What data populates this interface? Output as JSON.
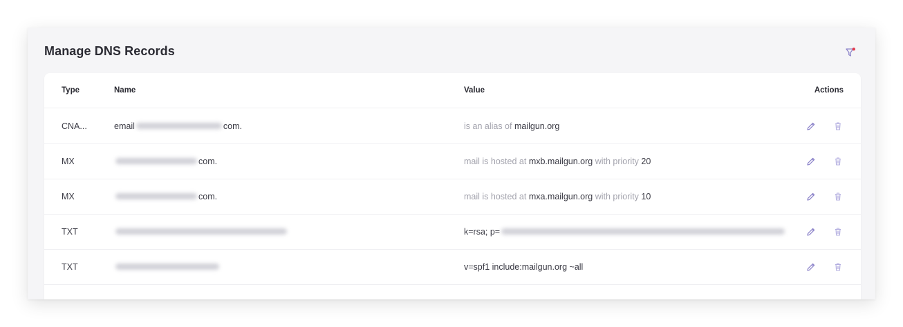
{
  "page": {
    "title": "Manage DNS Records"
  },
  "toolbar": {
    "filter_icon": "filter-icon"
  },
  "table": {
    "headers": {
      "type": "Type",
      "name": "Name",
      "value": "Value",
      "actions": "Actions"
    },
    "rows": [
      {
        "type": "CNA...",
        "name_prefix": "email",
        "name_suffix": "com.",
        "value_part1": "is an alias of",
        "value_part2": "mailgun.org",
        "value_part3": "",
        "value_part4": ""
      },
      {
        "type": "MX",
        "name_prefix": "",
        "name_suffix": "com.",
        "value_part1": "mail is hosted at",
        "value_part2": "mxb.mailgun.org",
        "value_part3": "with priority",
        "value_part4": "20"
      },
      {
        "type": "MX",
        "name_prefix": "",
        "name_suffix": "com.",
        "value_part1": "mail is hosted at",
        "value_part2": "mxa.mailgun.org",
        "value_part3": "with priority",
        "value_part4": "10"
      },
      {
        "type": "TXT",
        "name_prefix": "",
        "name_suffix": "",
        "value_part1": "",
        "value_part2": "k=rsa; p=",
        "value_part3": "",
        "value_part4": ""
      },
      {
        "type": "TXT",
        "name_prefix": "",
        "name_suffix": "",
        "value_part1": "",
        "value_part2": "v=spf1 include:mailgun.org ~all",
        "value_part3": "",
        "value_part4": ""
      }
    ]
  },
  "colors": {
    "accent": "#8b82c9",
    "danger_dot": "#e23b4e",
    "muted_text": "#a2a2ac"
  }
}
